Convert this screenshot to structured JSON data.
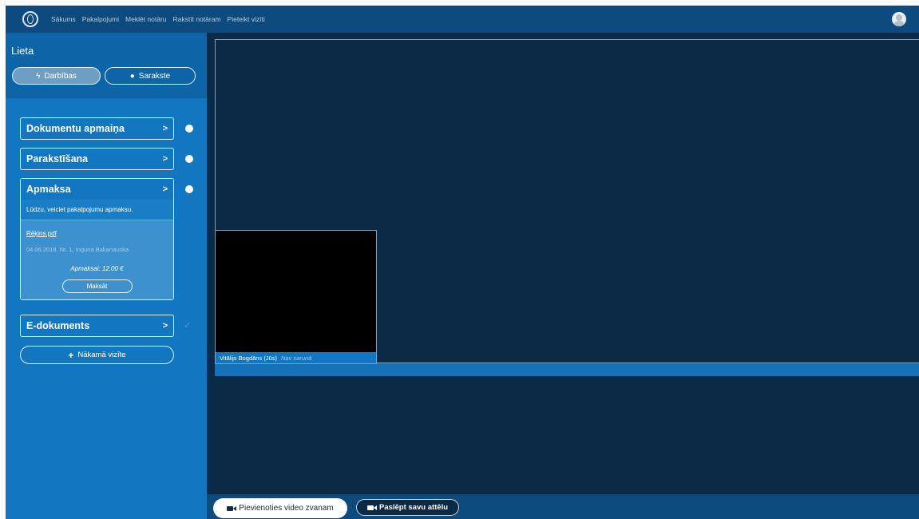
{
  "nav": {
    "links": [
      "Sākums",
      "Pakalpojumi",
      "Meklēt notāru",
      "Rakstīt notāram",
      "Pieteikt vizīti"
    ]
  },
  "sidebar": {
    "title": "Lieta",
    "tabs": [
      {
        "label": "Darbības",
        "icon": "bolt-icon",
        "active": true
      },
      {
        "label": "Sarakste",
        "icon": "chat-bubble-icon",
        "active": false
      }
    ],
    "steps": [
      {
        "label": "Dokumentu apmaiņa",
        "status": "pending"
      },
      {
        "label": "Parakstīšana",
        "status": "pending"
      },
      {
        "label": "Apmaksa",
        "status": "pending",
        "description": "Lūdzu, veiciet pakalpojumu apmaksu.",
        "file": "Rēķins.pdf",
        "file_meta": "04.06.2018. Nr. 1, Inguna Bakanauska",
        "amount": "Apmaksai: 12.00 €",
        "pay_label": "Maksāt"
      },
      {
        "label": "E-dokuments",
        "status": "done"
      }
    ],
    "next_visit_label": "Nākamā vizīte"
  },
  "video": {
    "self_name": "Vitālijs Bogdāns (Jūs)",
    "self_status": "Nav sarunā"
  },
  "controls": {
    "join_label": "Pievienoties video zvanam",
    "hide_label": "Paslēpt savu attēlu"
  },
  "colors": {
    "topbar": "#0d4a7d",
    "sidebar": "#1277c0",
    "video_bg": "#0b2a45"
  }
}
